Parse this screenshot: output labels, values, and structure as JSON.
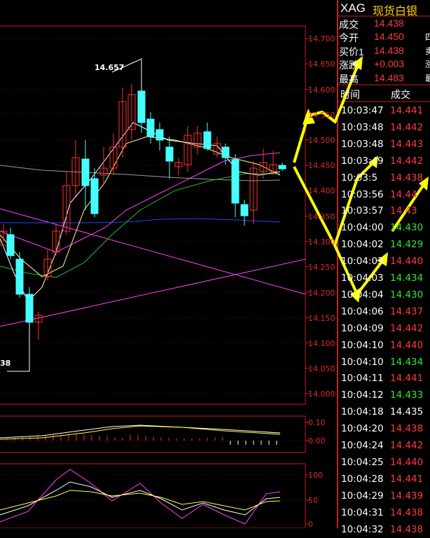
{
  "header": {
    "symbol": "XAG",
    "name": "现货白银"
  },
  "quote": [
    {
      "label": "成交",
      "value": "14.438",
      "cut": ""
    },
    {
      "label": "今开",
      "value": "14.450",
      "cut": "四"
    },
    {
      "label": "买价1",
      "value": "14.438",
      "cut": "卖"
    },
    {
      "label": "涨跌",
      "value": "+0.003",
      "cut": "涨"
    },
    {
      "label": "最高",
      "value": "14.483",
      "cut": "最"
    }
  ],
  "ticks_header": {
    "time": "时间",
    "trade": "成交"
  },
  "ticks": [
    {
      "time": "10:03:47",
      "price": "14.441",
      "color": "#ff3b3b"
    },
    {
      "time": "10:03:48",
      "price": "14.442",
      "color": "#ff3b3b"
    },
    {
      "time": "10:03:48",
      "price": "14.443",
      "color": "#ff3b3b"
    },
    {
      "time": "10:03:49",
      "price": "14.442",
      "color": "#ff3b3b"
    },
    {
      "time": "10:03:5",
      "price": "14.438",
      "color": "#ff3b3b"
    },
    {
      "time": "10:03:56",
      "price": "14.44",
      "color": "#ff3b3b"
    },
    {
      "time": "10:03:57",
      "price": "14.43",
      "color": "#ff3b3b"
    },
    {
      "time": "10:04:00",
      "price": "14.430",
      "color": "#2ee82e"
    },
    {
      "time": "10:04:02",
      "price": "14.429",
      "color": "#2ee82e"
    },
    {
      "time": "10:04:03",
      "price": "14.440",
      "color": "#ff3b3b"
    },
    {
      "time": "10:04:03",
      "price": "14.434",
      "color": "#2ee82e"
    },
    {
      "time": "10:04:04",
      "price": "14.430",
      "color": "#2ee82e"
    },
    {
      "time": "10:04:06",
      "price": "14.437",
      "color": "#ff3b3b"
    },
    {
      "time": "10:04:09",
      "price": "14.442",
      "color": "#ff3b3b"
    },
    {
      "time": "10:04:10",
      "price": "14.440",
      "color": "#ff3b3b"
    },
    {
      "time": "10:04:10",
      "price": "14.434",
      "color": "#2ee82e"
    },
    {
      "time": "10:04:11",
      "price": "14.441",
      "color": "#ff3b3b"
    },
    {
      "time": "10:04:12",
      "price": "14.433",
      "color": "#2ee82e"
    },
    {
      "time": "10:04:18",
      "price": "14.435",
      "color": "#ffffff"
    },
    {
      "time": "10:04:20",
      "price": "14.438",
      "color": "#ff3b3b"
    },
    {
      "time": "10:04:24",
      "price": "14.442",
      "color": "#ff3b3b"
    },
    {
      "time": "10:04:25",
      "price": "14.440",
      "color": "#ff3b3b"
    },
    {
      "time": "10:04:28",
      "price": "14.441",
      "color": "#ff3b3b"
    },
    {
      "time": "10:04:29",
      "price": "14.439",
      "color": "#ff3b3b"
    },
    {
      "time": "10:04:31",
      "price": "14.438",
      "color": "#ff3b3b"
    },
    {
      "time": "10:04:32",
      "price": "14.438",
      "color": "#ff3b3b"
    }
  ],
  "price_axis": [
    "14.700",
    "14.650",
    "14.600",
    "14.550",
    "14.500",
    "14.450",
    "14.400",
    "14.350",
    "14.300",
    "14.250",
    "14.200",
    "14.150",
    "14.100",
    "14.050",
    "14.000"
  ],
  "macd_axis": [
    "0.10",
    "0.00"
  ],
  "kdj_axis": [
    "100",
    "50",
    "0"
  ],
  "annotations": {
    "high": "14.657",
    "low_partial": "38"
  }
}
